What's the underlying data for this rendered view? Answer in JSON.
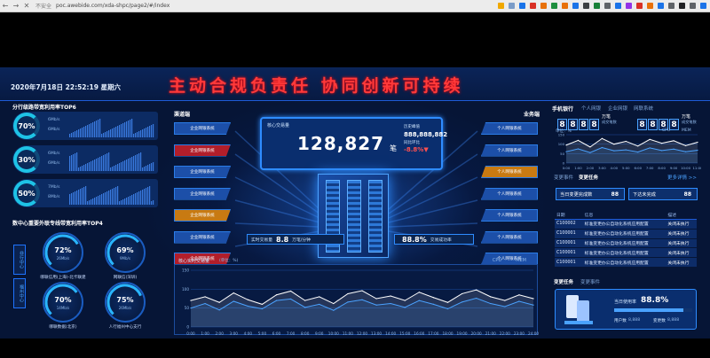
{
  "browser": {
    "back": "←",
    "forward": "→",
    "close": "✕",
    "security": "不安全",
    "url": "poc.awebide.com/xda-shpc/page2/#/index",
    "ext_colors": [
      "#f0a800",
      "#7b9cc8",
      "#1a73e8",
      "#d93025",
      "#e8710a",
      "#1e8e3e",
      "#e8710a",
      "#1a73e8",
      "#3c4043",
      "#188038",
      "#5f6368",
      "#1a73e8",
      "#9334e6",
      "#d93025",
      "#e8710a",
      "#1a73e8",
      "#5f6368",
      "#202124",
      "#5f6368",
      "#1a73e8"
    ]
  },
  "header": {
    "datetime": "2020年7月18日 22:52:19 星期六",
    "slogan": "主动合规负责任  协同创新可持续"
  },
  "left": {
    "top_title": "分行级路带宽利用率TOP6",
    "rings": [
      {
        "pct": "70%",
        "up": "6Mb/s",
        "down": "6Mb/s"
      },
      {
        "pct": "30%",
        "up": "6Mb/s",
        "down": "6Mb/s"
      },
      {
        "pct": "50%",
        "up": "7Mb/s",
        "down": "8Mb/s"
      }
    ],
    "gauge_title": "数中心重要外联专线带宽利用率TOP4",
    "tab1": "非行中心",
    "tab2": "福州中心",
    "gauges": [
      {
        "value": "72%",
        "unit": "26Mb/s",
        "label": "哪联信用(上海)-北卡联建",
        "ratio": 0.72
      },
      {
        "value": "69%",
        "unit": "9Mb/s",
        "label": "网联信(深圳)",
        "ratio": 0.69
      },
      {
        "value": "70%",
        "unit": "14Mb/s",
        "label": "哪联数据(北京)",
        "ratio": 0.7
      },
      {
        "value": "75%",
        "unit": "26Mb/s",
        "label": "人行福州中心支行",
        "ratio": 0.75
      }
    ]
  },
  "center": {
    "left_col_title": "渠道端",
    "right_col_title": "业务端",
    "left_systems": [
      {
        "label": "企业网银系统",
        "color": "#1c4fa8"
      },
      {
        "label": "企业网银系统",
        "color": "#b21e2a"
      },
      {
        "label": "企业网银系统",
        "color": "#1c4fa8"
      },
      {
        "label": "企业网银系统",
        "color": "#1c4fa8"
      },
      {
        "label": "企业网银系统",
        "color": "#c87a12"
      },
      {
        "label": "企业网银系统",
        "color": "#1c4fa8"
      },
      {
        "label": "企业网银系统",
        "color": "#b21e2a"
      }
    ],
    "right_systems": [
      {
        "label": "个人网银系统",
        "color": "#1c4fa8"
      },
      {
        "label": "个人网银系统",
        "color": "#1c4fa8"
      },
      {
        "label": "个人网银系统",
        "color": "#c87a12"
      },
      {
        "label": "个人网银系统",
        "color": "#1c4fa8"
      },
      {
        "label": "个人网银系统",
        "color": "#1c4fa8"
      },
      {
        "label": "个人网银系统",
        "color": "#1c4fa8"
      },
      {
        "label": "个人网银系统",
        "color": "#1c4fa8"
      }
    ],
    "core": {
      "label": "核心交易量",
      "value": "128,827",
      "unit": "笔",
      "hist_label": "历史峰值",
      "hist_value": "888,888,882",
      "ratio_label": "同比环比",
      "ratio_value": "-8.8%▼"
    },
    "stat_left": {
      "label": "实时交易量",
      "value": "8.8",
      "unit": "万笔/分钟"
    },
    "stat_right": {
      "value": "88.8%",
      "label": "交易成功率"
    },
    "chart_title": "核心实时交易量",
    "chart_unit": "(单位：%)",
    "legend": [
      "CPU",
      "MEM"
    ]
  },
  "right": {
    "title": "手机银行",
    "tabs": [
      "个人网银",
      "企业网银",
      "网联系统"
    ],
    "counter1": {
      "digits": [
        "8",
        "8",
        "8",
        "8"
      ],
      "unit": "万笔",
      "label": "成交笔数"
    },
    "counter2": {
      "digits": [
        "8",
        "8",
        "8",
        "8"
      ],
      "unit": "万笔",
      "label": "成交笔数"
    },
    "mini_unit": "单位：%",
    "mini_legend": [
      "CPU",
      "MEM"
    ],
    "tabs2": [
      "变更事件",
      "变更任务"
    ],
    "more": "更多详情 >>",
    "card1": {
      "label": "当日变更完成数",
      "value": "88"
    },
    "card2": {
      "label": "下达未完成",
      "value": "88"
    },
    "table_headers": [
      "日期",
      "信息",
      "描述"
    ],
    "table_rows": [
      [
        "C100002",
        "标准变更办公自动化系统应用配置",
        "关闭未执行"
      ],
      [
        "C100001",
        "标准变更办公自动化系统应用配置",
        "关闭未执行"
      ],
      [
        "C100001",
        "标准变更办公自动化系统应用配置",
        "关闭未执行"
      ],
      [
        "C100001",
        "标准变更办公自动化系统应用配置",
        "关闭未执行"
      ],
      [
        "C100001",
        "标准变更办公自动化系统应用配置",
        "关闭未执行"
      ]
    ],
    "tabs3": [
      "变更任务",
      "变更事件"
    ],
    "util_label": "当日使用率",
    "util_value": "88.8%",
    "util_ratio": 0.888,
    "users_label": "用户数",
    "users_value": "8,888",
    "changes_label": "变更数",
    "changes_value": "8,888"
  },
  "chart_data": [
    {
      "type": "line",
      "title": "核心实时交易量",
      "ylabel": "(单位：%)",
      "x": [
        "0:00",
        "1:00",
        "2:00",
        "3:00",
        "4:00",
        "5:00",
        "6:00",
        "7:00",
        "8:00",
        "9:00",
        "10:00",
        "11:00",
        "12:00",
        "13:00",
        "14:00",
        "15:00",
        "16:00",
        "17:00",
        "18:00",
        "19:00",
        "20:00",
        "21:00",
        "22:00",
        "23:00",
        "24:00"
      ],
      "ylim": [
        0,
        150
      ],
      "yticks": [
        0,
        50,
        100,
        150
      ],
      "series": [
        {
          "name": "CPU",
          "color": "#ffffff",
          "values": [
            70,
            80,
            65,
            90,
            72,
            60,
            85,
            95,
            70,
            80,
            62,
            88,
            96,
            75,
            82,
            70,
            92,
            78,
            65,
            88,
            98,
            80,
            70,
            85,
            75
          ]
        },
        {
          "name": "MEM",
          "color": "#4aa2ff",
          "values": [
            50,
            62,
            45,
            68,
            55,
            48,
            70,
            74,
            52,
            60,
            44,
            66,
            72,
            58,
            62,
            52,
            70,
            60,
            48,
            66,
            76,
            62,
            54,
            68,
            58
          ]
        }
      ]
    },
    {
      "type": "line",
      "x": [
        "0:00",
        "1:00",
        "2:00",
        "3:00",
        "4:00",
        "5:00",
        "6:00",
        "7:00",
        "8:00",
        "9:00",
        "10:00",
        "11:00"
      ],
      "ylim": [
        0,
        150
      ],
      "yticks": [
        0,
        50,
        100,
        150
      ],
      "series": [
        {
          "name": "CPU",
          "color": "#ffffff",
          "values": [
            95,
            120,
            85,
            130,
            100,
            115,
            90,
            125,
            105,
            118,
            92,
            110
          ]
        },
        {
          "name": "MEM",
          "color": "#4aa2ff",
          "values": [
            60,
            75,
            55,
            82,
            65,
            70,
            58,
            80,
            66,
            74,
            60,
            68
          ]
        }
      ]
    }
  ]
}
